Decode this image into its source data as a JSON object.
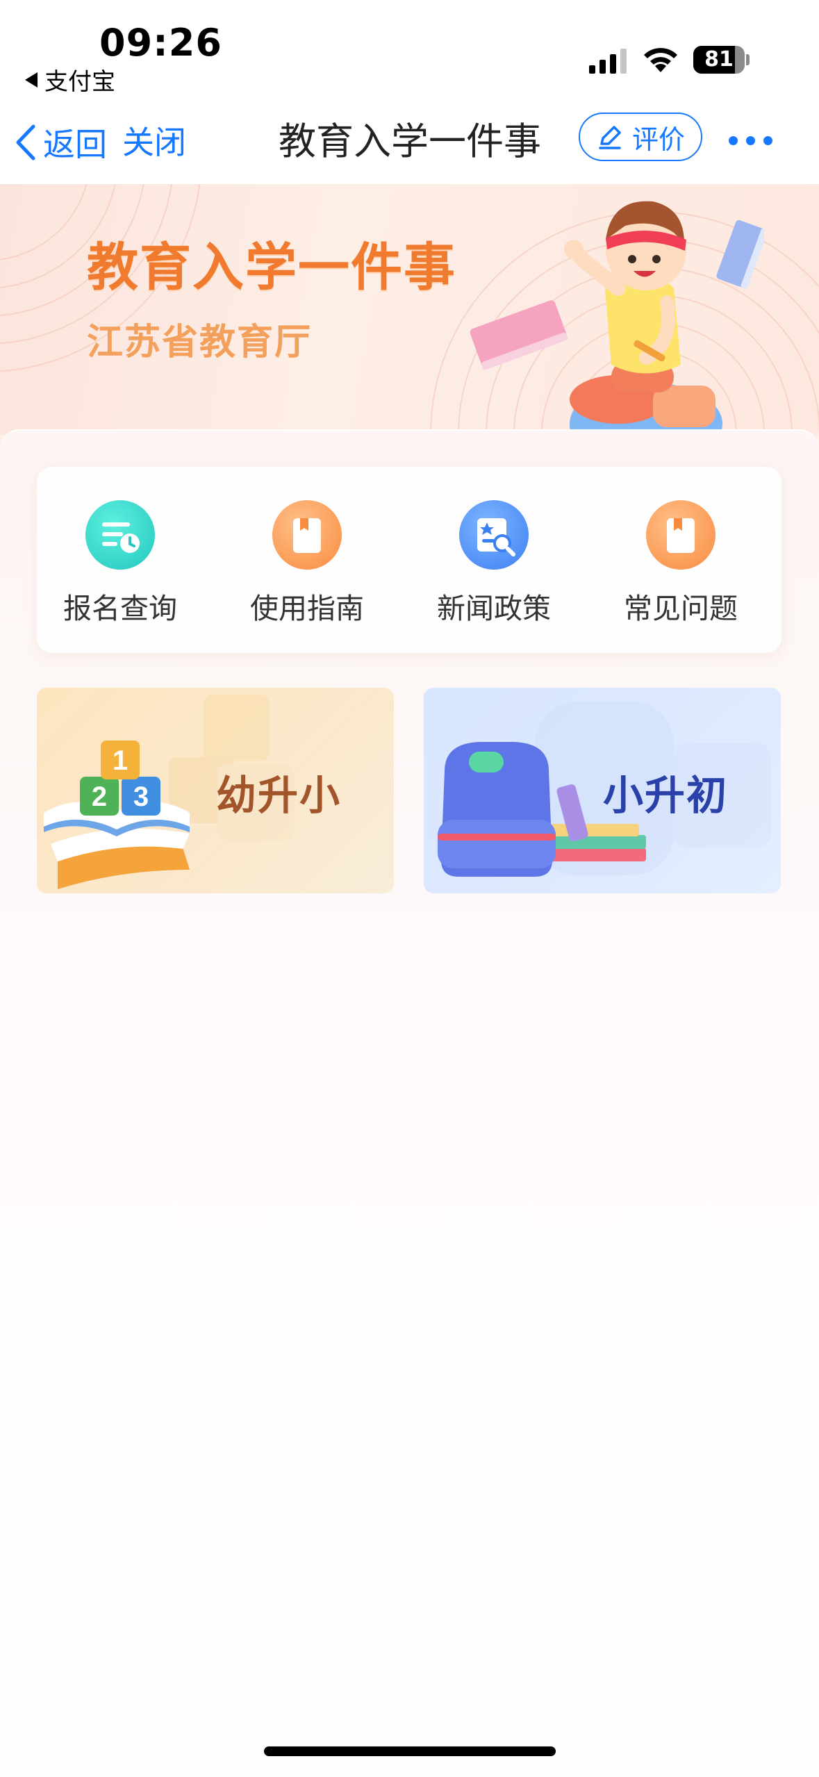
{
  "status_bar": {
    "time": "09:26",
    "back_app": "支付宝",
    "battery": "81"
  },
  "nav": {
    "back_label": "返回",
    "close_label": "关闭",
    "title": "教育入学一件事",
    "rate_label": "评价"
  },
  "banner": {
    "title": "教育入学一件事",
    "subtitle": "江苏省教育厅"
  },
  "quick_links": [
    {
      "label": "报名查询",
      "icon": "registration-query-icon",
      "color": "#2ccbc0"
    },
    {
      "label": "使用指南",
      "icon": "guide-book-icon",
      "color": "#f98b3e"
    },
    {
      "label": "新闻政策",
      "icon": "news-policy-icon",
      "color": "#3b80f3"
    },
    {
      "label": "常见问题",
      "icon": "faq-book-icon",
      "color": "#f98b3e"
    }
  ],
  "entries": [
    {
      "label": "幼升小",
      "icon": "abc-blocks-book-icon"
    },
    {
      "label": "小升初",
      "icon": "backpack-books-icon"
    }
  ],
  "colors": {
    "accent": "#1677ff",
    "banner_title": "#f07b2e",
    "banner_subtitle": "#f3a05c"
  }
}
